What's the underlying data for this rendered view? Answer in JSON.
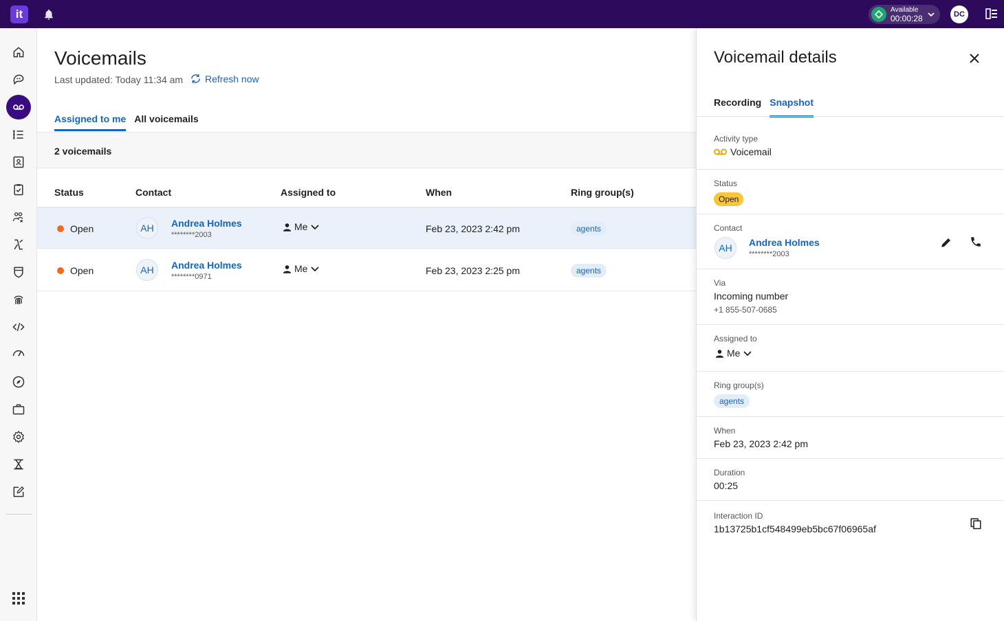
{
  "app": {
    "logo_text": "it",
    "presence": {
      "label": "Available",
      "timer": "00:00:28"
    },
    "user_initials": "DC"
  },
  "sidebar": {
    "items": [
      {
        "icon": "home-icon"
      },
      {
        "icon": "conversations-icon"
      },
      {
        "icon": "voicemail-icon",
        "active": true
      },
      {
        "icon": "list-icon"
      },
      {
        "icon": "contacts-icon"
      },
      {
        "icon": "clipboard-check-icon"
      },
      {
        "icon": "team-icon"
      },
      {
        "icon": "routing-icon"
      },
      {
        "icon": "shield-icon"
      },
      {
        "icon": "fingerprint-icon"
      },
      {
        "icon": "code-icon"
      },
      {
        "icon": "gauge-icon"
      },
      {
        "icon": "compass-icon"
      },
      {
        "icon": "briefcase-icon"
      },
      {
        "icon": "gear-icon"
      },
      {
        "icon": "training-icon"
      },
      {
        "icon": "edit-icon"
      }
    ]
  },
  "main": {
    "title": "Voicemails",
    "updated": "Last updated: Today 11:34 am",
    "refresh_label": "Refresh now",
    "tabs": [
      {
        "label": "Assigned to me",
        "active": true
      },
      {
        "label": "All voicemails",
        "active": false
      }
    ],
    "count": "2 voicemails",
    "columns": [
      "Status",
      "Contact",
      "Assigned to",
      "When",
      "Ring group(s)"
    ],
    "rows": [
      {
        "status": "Open",
        "initials": "AH",
        "name": "Andrea Holmes",
        "number": "********2003",
        "assigned": "Me",
        "when": "Feb 23, 2023 2:42 pm",
        "ring_group": "agents",
        "selected": true
      },
      {
        "status": "Open",
        "initials": "AH",
        "name": "Andrea Holmes",
        "number": "********0971",
        "assigned": "Me",
        "when": "Feb 23, 2023 2:25 pm",
        "ring_group": "agents",
        "selected": false
      }
    ]
  },
  "details": {
    "title": "Voicemail details",
    "tabs": [
      {
        "label": "Recording",
        "active": false
      },
      {
        "label": "Snapshot",
        "active": true
      }
    ],
    "activity_type": {
      "label": "Activity type",
      "value": "Voicemail"
    },
    "status": {
      "label": "Status",
      "value": "Open"
    },
    "contact": {
      "label": "Contact",
      "initials": "AH",
      "name": "Andrea Holmes",
      "number": "********2003"
    },
    "via": {
      "label": "Via",
      "value": "Incoming number",
      "number": "+1 855-507-0685"
    },
    "assigned": {
      "label": "Assigned to",
      "value": "Me"
    },
    "ring_groups": {
      "label": "Ring group(s)",
      "value": "agents"
    },
    "when": {
      "label": "When",
      "value": "Feb 23, 2023 2:42 pm"
    },
    "duration": {
      "label": "Duration",
      "value": "00:25"
    },
    "interaction_id": {
      "label": "Interaction ID",
      "value": "1b13725b1cf548499eb5bc67f06965af"
    }
  },
  "colors": {
    "topbar": "#2e0a5c",
    "accent": "#1565c0",
    "open_dot": "#ef6b1f",
    "open_badge": "#f9c53b",
    "available": "#1ea672"
  }
}
